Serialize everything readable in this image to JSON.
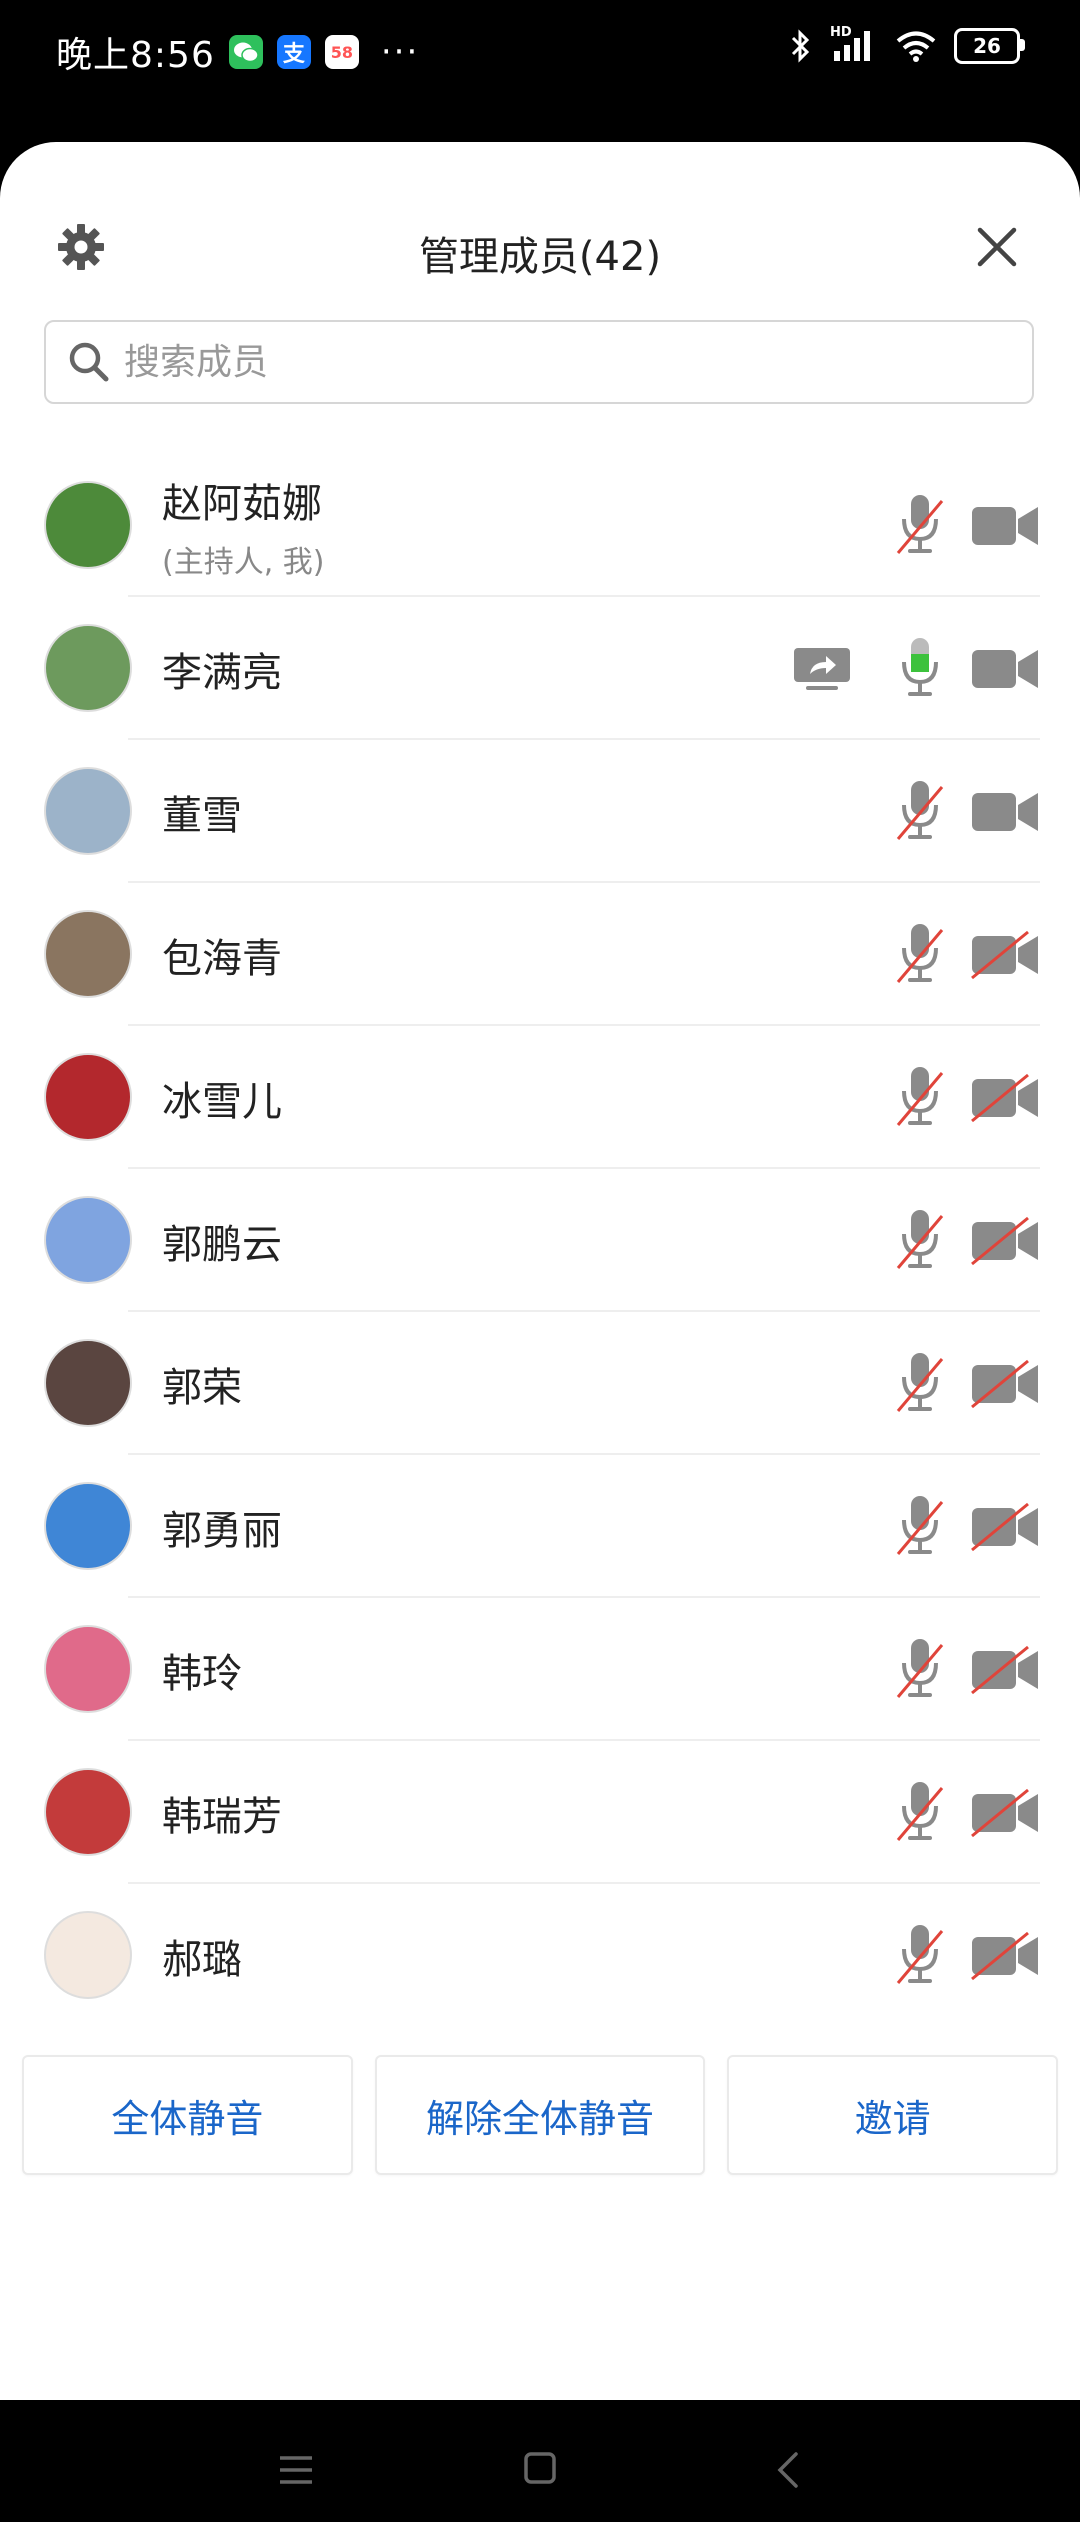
{
  "statusbar": {
    "time": "晚上8:56",
    "apps": [
      "wechat-icon",
      "alipay-icon",
      "58-icon"
    ],
    "alipay_glyph": "支",
    "app58_glyph": "58",
    "more": "···",
    "signal_label": "HD",
    "battery": "26"
  },
  "header": {
    "title": "管理成员(42)",
    "settings_icon": "gear-icon",
    "close_icon": "close-icon"
  },
  "search": {
    "placeholder": "搜索成员",
    "value": ""
  },
  "members": [
    {
      "name": "赵阿茹娜",
      "sub": "(主持人, 我)",
      "mic": "muted",
      "cam": "on",
      "sharing": false,
      "avatar_color": "#4d8a3a"
    },
    {
      "name": "李满亮",
      "sub": "",
      "mic": "active",
      "cam": "on",
      "sharing": true,
      "avatar_color": "#6d9a5d"
    },
    {
      "name": "董雪",
      "sub": "",
      "mic": "muted",
      "cam": "on",
      "sharing": false,
      "avatar_color": "#9cb3c9"
    },
    {
      "name": "包海青",
      "sub": "",
      "mic": "muted",
      "cam": "off",
      "sharing": false,
      "avatar_color": "#8a7560"
    },
    {
      "name": "冰雪儿",
      "sub": "",
      "mic": "muted",
      "cam": "off",
      "sharing": false,
      "avatar_color": "#b3282d"
    },
    {
      "name": "郭鹏云",
      "sub": "",
      "mic": "muted",
      "cam": "off",
      "sharing": false,
      "avatar_color": "#7fa4e0"
    },
    {
      "name": "郭荣",
      "sub": "",
      "mic": "muted",
      "cam": "off",
      "sharing": false,
      "avatar_color": "#5a4540"
    },
    {
      "name": "郭勇丽",
      "sub": "",
      "mic": "muted",
      "cam": "off",
      "sharing": false,
      "avatar_color": "#3f86d6"
    },
    {
      "name": "韩玲",
      "sub": "",
      "mic": "muted",
      "cam": "off",
      "sharing": false,
      "avatar_color": "#e06a8a"
    },
    {
      "name": "韩瑞芳",
      "sub": "",
      "mic": "muted",
      "cam": "off",
      "sharing": false,
      "avatar_color": "#c33b3b"
    },
    {
      "name": "郝璐",
      "sub": "",
      "mic": "muted",
      "cam": "off",
      "sharing": false,
      "avatar_color": "#f4e9e0"
    }
  ],
  "actions": {
    "mute_all": "全体静音",
    "unmute_all": "解除全体静音",
    "invite": "邀请"
  },
  "colors": {
    "accent": "#1a66c9",
    "icon_gray": "#8a8a8a",
    "mute_red": "#e0443a",
    "mic_green": "#3cc23c"
  },
  "navbar": {
    "menu_icon": "menu-icon",
    "home_icon": "home-icon",
    "back_icon": "back-icon"
  }
}
